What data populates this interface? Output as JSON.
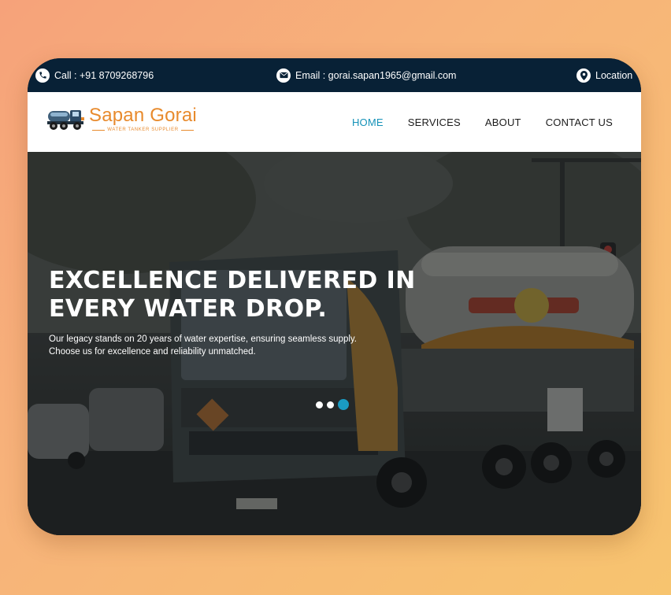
{
  "topbar": {
    "call": "Call : +91 8709268796",
    "email": "Email : gorai.sapan1965@gmail.com",
    "location": "Location"
  },
  "brand": {
    "name": "Sapan Gorai",
    "tagline": "WATER TANKER SUPPLIER"
  },
  "nav": [
    {
      "label": "HOME",
      "active": true
    },
    {
      "label": "SERVICES",
      "active": false
    },
    {
      "label": "ABOUT",
      "active": false
    },
    {
      "label": "CONTACT US",
      "active": false
    }
  ],
  "hero": {
    "title_line1": "EXCELLENCE DELIVERED IN",
    "title_line2": "EVERY WATER DROP.",
    "subtitle_line1": "Our legacy stands on 20 years of water expertise, ensuring seamless supply.",
    "subtitle_line2": "Choose us for excellence and reliability unmatched."
  },
  "carousel": {
    "slides": 3,
    "active_slide": 3
  },
  "colors": {
    "topbar_bg": "#082136",
    "accent": "#1a9bc3",
    "brand_orange": "#e88a2c",
    "background_from": "#f6a27a",
    "background_to": "#f7c46f"
  }
}
